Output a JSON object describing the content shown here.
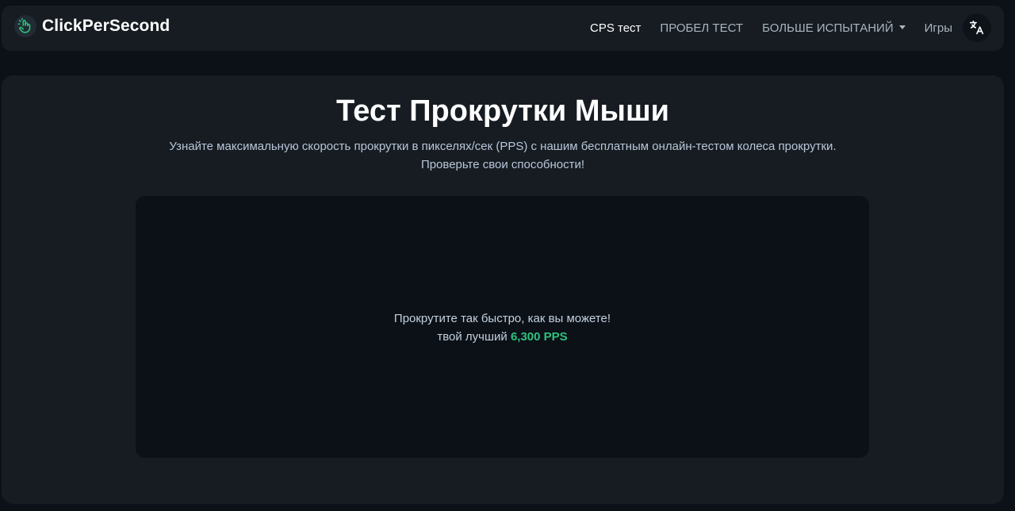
{
  "brand": {
    "name": "ClickPerSecond",
    "icon": "hand-click-icon",
    "accent": "#2ec27e"
  },
  "nav": {
    "items": [
      {
        "label": "CPS тест",
        "active": true
      },
      {
        "label": "ПРОБЕЛ ТЕСТ",
        "active": false
      },
      {
        "label": "БОЛЬШЕ ИСПЫТАНИЙ",
        "active": false,
        "dropdown": true
      },
      {
        "label": "Игры",
        "active": false
      }
    ],
    "language_icon": "translate-icon"
  },
  "main": {
    "title": "Тест Прокрутки Мыши",
    "subtitle_line1": "Узнайте максимальную скорость прокрутки в пикселях/сек (PPS) с нашим бесплатным онлайн-тестом колеса прокрутки.",
    "subtitle_line2": "Проверьте свои способности!",
    "scroll_area": {
      "prompt": "Прокрутите так быстро, как вы можете!",
      "best_label": "твой лучший",
      "best_value": "6,300 PPS"
    }
  }
}
